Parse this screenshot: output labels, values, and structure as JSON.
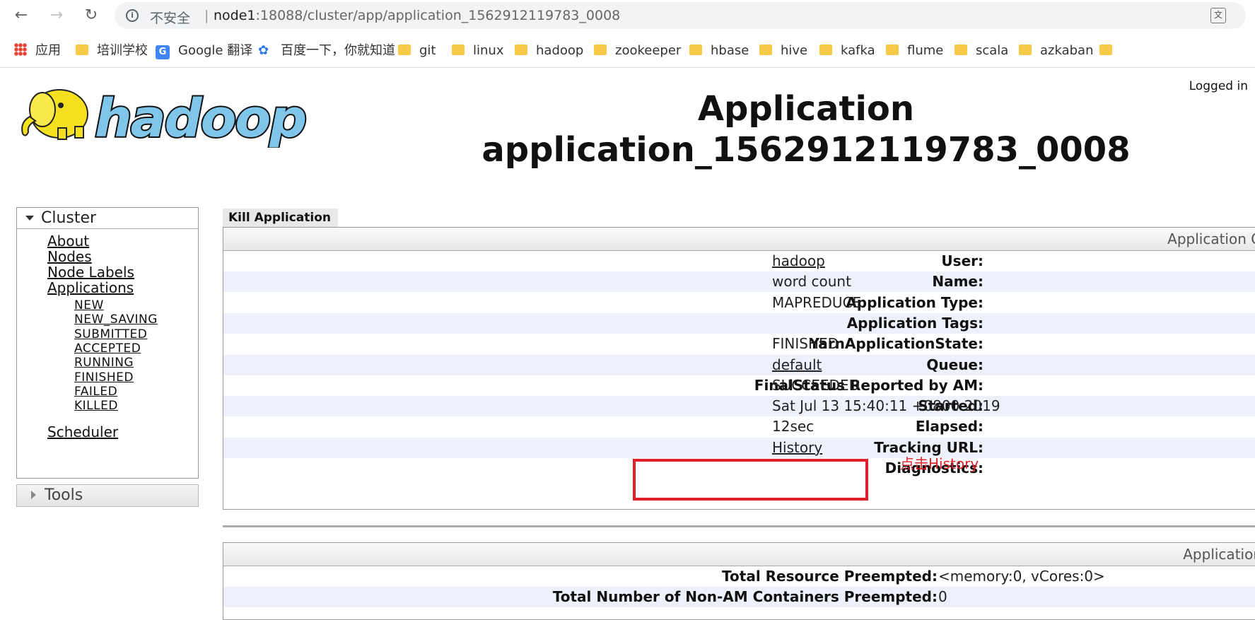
{
  "browser": {
    "insecure_label": "不安全",
    "url_host": "node1",
    "url_rest": ":18088/cluster/app/application_1562912119783_0008",
    "bookmarks": [
      "应用",
      "培训学校",
      "Google 翻译",
      "百度一下，你就知道",
      "git",
      "linux",
      "hadoop",
      "zookeeper",
      "hbase",
      "hive",
      "kafka",
      "flume",
      "scala",
      "azkaban"
    ]
  },
  "header": {
    "logged_in": "Logged in",
    "title_line1": "Application",
    "title_line2": "application_1562912119783_0008"
  },
  "sidebar": {
    "cluster_label": "Cluster",
    "links": [
      "About",
      "Nodes",
      "Node Labels",
      "Applications"
    ],
    "app_states": [
      "NEW",
      "NEW_SAVING",
      "SUBMITTED",
      "ACCEPTED",
      "RUNNING",
      "FINISHED",
      "FAILED",
      "KILLED"
    ],
    "scheduler": "Scheduler",
    "tools_label": "Tools"
  },
  "main": {
    "kill_button": "Kill Application",
    "overview_header": "Application O",
    "rows": [
      {
        "key": "User:",
        "value": "hadoop",
        "link": true
      },
      {
        "key": "Name:",
        "value": "word count",
        "link": false
      },
      {
        "key": "Application Type:",
        "value": "MAPREDUCE",
        "link": false
      },
      {
        "key": "Application Tags:",
        "value": "",
        "link": false
      },
      {
        "key": "YarnApplicationState:",
        "value": "FINISHED",
        "link": false
      },
      {
        "key": "Queue:",
        "value": "default",
        "link": true
      },
      {
        "key": "FinalStatus Reported by AM:",
        "value": "SUCCEEDED",
        "link": false
      },
      {
        "key": "Started:",
        "value": "Sat Jul 13 15:40:11 +0800 2019",
        "link": false
      },
      {
        "key": "Elapsed:",
        "value": "12sec",
        "link": false
      },
      {
        "key": "Tracking URL:",
        "value": "History",
        "link": true
      },
      {
        "key": "Diagnostics:",
        "value": "",
        "link": false
      }
    ],
    "annotation": "点击History",
    "metrics_header": "Application",
    "metrics": [
      {
        "key": "Total Resource Preempted:",
        "value": "<memory:0, vCores:0>"
      },
      {
        "key": "Total Number of Non-AM Containers Preempted:",
        "value": "0"
      }
    ]
  },
  "colors": {
    "highlight": "#e0202a",
    "row_alt": "#eef1fb"
  }
}
